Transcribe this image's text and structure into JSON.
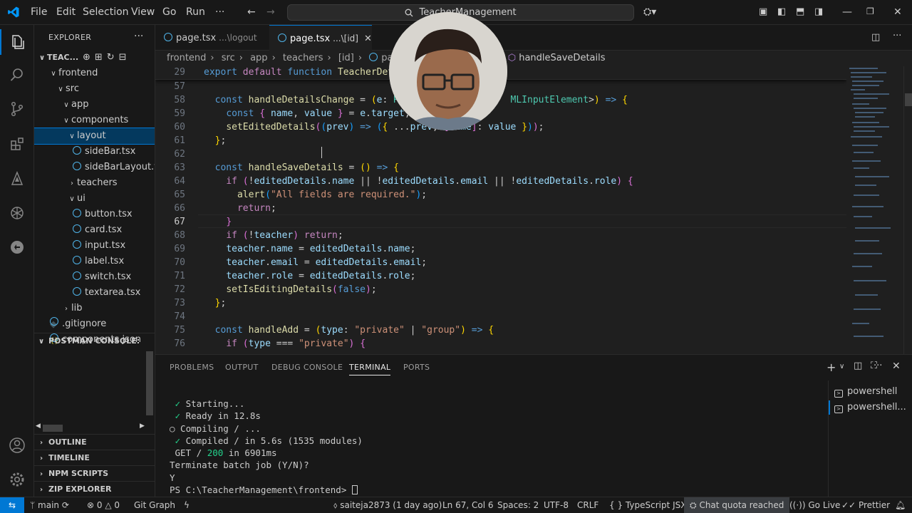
{
  "titlebar": {
    "menus": [
      "File",
      "Edit",
      "Selection",
      "View",
      "Go",
      "Run",
      "···"
    ],
    "search_text": "TeacherManagement"
  },
  "sidebar": {
    "header": "EXPLORER",
    "more": "···",
    "project": "TEAC...",
    "tree": [
      {
        "label": "frontend",
        "kind": "folder-open"
      },
      {
        "label": "src",
        "kind": "folder-open"
      },
      {
        "label": "app",
        "kind": "folder-open"
      },
      {
        "label": "components",
        "kind": "folder-open"
      },
      {
        "label": "layout",
        "kind": "folder-open"
      },
      {
        "label": "sideBar.tsx",
        "kind": "file"
      },
      {
        "label": "sideBarLayout.tsx",
        "kind": "file"
      },
      {
        "label": "teachers",
        "kind": "folder-closed"
      },
      {
        "label": "ui",
        "kind": "folder-open"
      },
      {
        "label": "button.tsx",
        "kind": "file"
      },
      {
        "label": "card.tsx",
        "kind": "file"
      },
      {
        "label": "input.tsx",
        "kind": "file"
      },
      {
        "label": "label.tsx",
        "kind": "file"
      },
      {
        "label": "switch.tsx",
        "kind": "file"
      },
      {
        "label": "textarea.tsx",
        "kind": "file"
      },
      {
        "label": "lib",
        "kind": "folder-closed"
      },
      {
        "label": ".gitignore",
        "kind": "file-git"
      },
      {
        "label": "components.json",
        "kind": "file-json"
      }
    ],
    "postman": "POSTMAN CONSOLE:",
    "sections": [
      "OUTLINE",
      "TIMELINE",
      "NPM SCRIPTS",
      "ZIP EXPLORER"
    ]
  },
  "tabs": [
    {
      "name": "page.tsx",
      "desc": "...\\logout",
      "active": false
    },
    {
      "name": "page.tsx",
      "desc": "...\\[id]",
      "active": true,
      "close": "✕"
    }
  ],
  "breadcrumb": [
    "frontend",
    "src",
    "app",
    "teachers",
    "[id]",
    "page.tsx",
    "handleSaveDetails"
  ],
  "editor": {
    "current_line": "67",
    "sticky_line": "29",
    "line_numbers": [
      "57",
      "58",
      "59",
      "60",
      "61",
      "62",
      "63",
      "64",
      "65",
      "66",
      "67",
      "68",
      "69",
      "70",
      "71",
      "72",
      "73",
      "74",
      "75",
      "76"
    ]
  },
  "panel": {
    "tabs": [
      "PROBLEMS",
      "OUTPUT",
      "DEBUG CONSOLE",
      "TERMINAL",
      "PORTS"
    ],
    "active_tab": "TERMINAL",
    "terminal_lines": [
      {
        "check": true,
        "text": "Starting..."
      },
      {
        "check": true,
        "text": "Ready in 12.8s"
      },
      {
        "check": false,
        "text": "○ Compiling / ..."
      },
      {
        "check": true,
        "text": "Compiled / in 5.6s (1535 modules)"
      },
      {
        "check": false,
        "text": " GET / ",
        "status": "200",
        "rest": " in 6901ms"
      },
      {
        "check": false,
        "text": "Terminate batch job (Y/N)?"
      },
      {
        "check": false,
        "text": "Y"
      },
      {
        "check": false,
        "text": "PS C:\\TeacherManagement\\frontend> "
      }
    ],
    "terminals": [
      "powershell",
      "powershell..."
    ]
  },
  "statusbar": {
    "branch": "main",
    "errors": "0",
    "warnings": "0",
    "git_graph": "Git Graph",
    "author": "saiteja2873 (1 day ago)",
    "position": "Ln 67, Col 6",
    "spaces": "Spaces: 2",
    "encoding": "UTF-8",
    "eol": "CRLF",
    "language": "TypeScript JSX",
    "chat": "Chat quota reached",
    "golive": "Go Live",
    "prettier": "Prettier"
  },
  "colors": {
    "accent": "#0078d4",
    "background": "#1f1f1f",
    "sidebar_bg": "#181818"
  }
}
